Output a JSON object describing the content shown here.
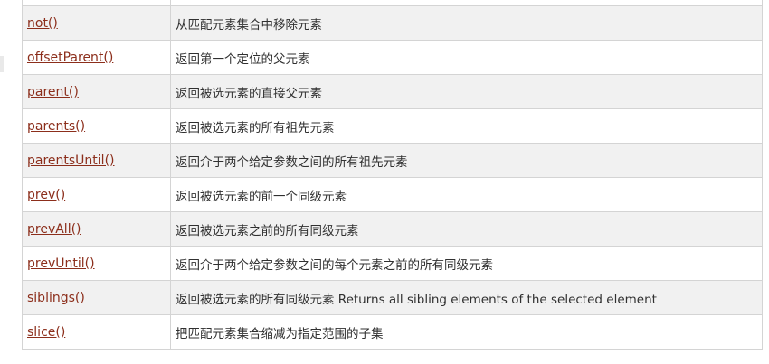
{
  "methods": [
    {
      "name": "not()",
      "description": "从匹配元素集合中移除元素"
    },
    {
      "name": "offsetParent()",
      "description": "返回第一个定位的父元素"
    },
    {
      "name": "parent()",
      "description": "返回被选元素的直接父元素"
    },
    {
      "name": "parents()",
      "description": "返回被选元素的所有祖先元素"
    },
    {
      "name": "parentsUntil()",
      "description": "返回介于两个给定参数之间的所有祖先元素"
    },
    {
      "name": "prev()",
      "description": "返回被选元素的前一个同级元素"
    },
    {
      "name": "prevAll()",
      "description": "返回被选元素之前的所有同级元素"
    },
    {
      "name": "prevUntil()",
      "description": "返回介于两个给定参数之间的每个元素之前的所有同级元素"
    },
    {
      "name": "siblings()",
      "description": "返回被选元素的所有同级元素 Returns all sibling elements of the selected element"
    },
    {
      "name": "slice()",
      "description": "把匹配元素集合缩减为指定范围的子集"
    }
  ],
  "colors": {
    "link": "#8c2e1b",
    "row_odd": "#f1f1f1",
    "row_even": "#ffffff",
    "border": "#d4d4d4"
  }
}
